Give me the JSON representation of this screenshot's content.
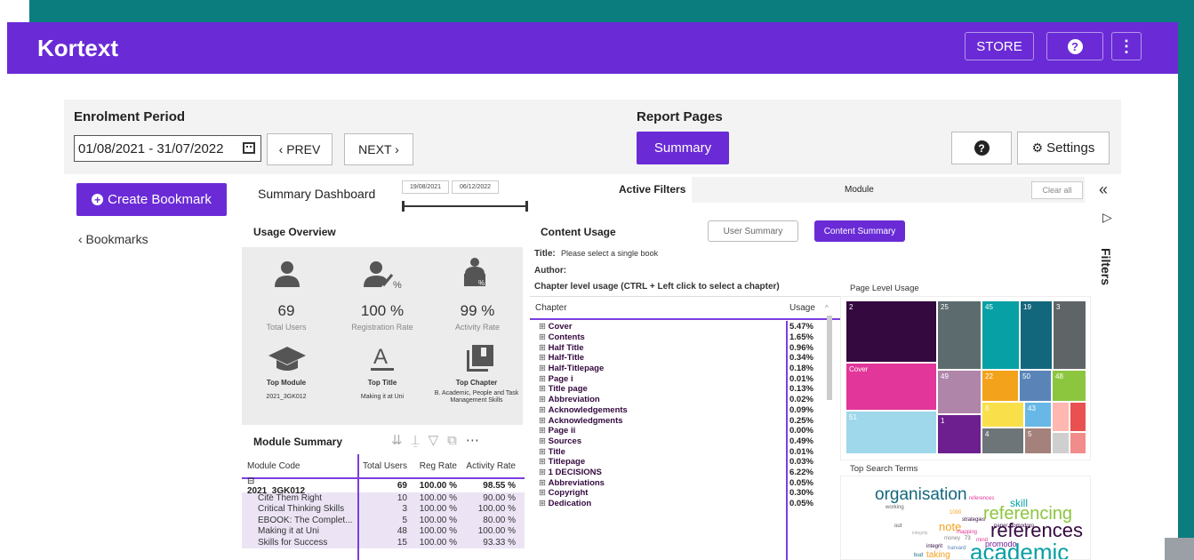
{
  "header": {
    "logo": "Kortext",
    "store_label": "STORE"
  },
  "filters": {
    "enrolment_label": "Enrolment Period",
    "date_range": "01/08/2021 - 31/07/2022",
    "prev_label": "‹ PREV",
    "next_label": "NEXT ›",
    "report_pages_label": "Report Pages",
    "summary_label": "Summary",
    "settings_label": "Settings"
  },
  "sidebar": {
    "create_bookmark": "Create Bookmark",
    "bookmarks": "‹ Bookmarks"
  },
  "dashboard": {
    "title": "Summary Dashboard",
    "slider_start": "19/08/2021",
    "slider_end": "06/12/2022",
    "active_filters_label": "Active Filters",
    "module_filter": "Module",
    "clear_all": "Clear all"
  },
  "usage_overview": {
    "title": "Usage Overview",
    "total_users_value": "69",
    "total_users_label": "Total Users",
    "reg_rate_value": "100 %",
    "reg_rate_label": "Registration Rate",
    "activity_rate_value": "99 %",
    "activity_rate_label": "Activity Rate",
    "top_module_label": "Top Module",
    "top_module_value": "2021_3GK012",
    "top_title_label": "Top Title",
    "top_title_value": "Making it at Uni",
    "top_chapter_label": "Top Chapter",
    "top_chapter_value": "B. Academic, People and Task Management Skills"
  },
  "module_summary": {
    "title": "Module Summary",
    "headers": [
      "Module Code",
      "Total Users",
      "Reg Rate",
      "Activity Rate"
    ],
    "group": {
      "code": "2021_3GK012",
      "users": "69",
      "reg": "100.00 %",
      "activity": "98.55 %"
    },
    "rows": [
      {
        "code": "Cite Them Right",
        "users": "10",
        "reg": "100.00 %",
        "activity": "90.00 %"
      },
      {
        "code": "Critical Thinking Skills",
        "users": "3",
        "reg": "100.00 %",
        "activity": "100.00 %"
      },
      {
        "code": "EBOOK: The Complet...",
        "users": "5",
        "reg": "100.00 %",
        "activity": "80.00 %"
      },
      {
        "code": "Making it at Uni",
        "users": "48",
        "reg": "100.00 %",
        "activity": "100.00 %"
      },
      {
        "code": "Skills for Success",
        "users": "15",
        "reg": "100.00 %",
        "activity": "93.33 %"
      }
    ]
  },
  "content_usage": {
    "title": "Content Usage",
    "user_summary": "User Summary",
    "content_summary": "Content Summary",
    "title_label": "Title:",
    "title_value": "Please select a single book",
    "author_label": "Author:",
    "chapter_hint": "Chapter level usage (CTRL + Left click to select a chapter)",
    "headers": [
      "Chapter",
      "Usage"
    ],
    "rows": [
      {
        "chapter": "Cover",
        "usage": "5.47%"
      },
      {
        "chapter": "Contents",
        "usage": "1.65%"
      },
      {
        "chapter": "Half Title",
        "usage": "0.96%"
      },
      {
        "chapter": "Half-Title",
        "usage": "0.34%"
      },
      {
        "chapter": "Half-Titlepage",
        "usage": "0.18%"
      },
      {
        "chapter": "Page i",
        "usage": "0.01%"
      },
      {
        "chapter": "Title page",
        "usage": "0.13%"
      },
      {
        "chapter": "Abbreviation",
        "usage": "0.02%"
      },
      {
        "chapter": "Acknowledgements",
        "usage": "0.09%"
      },
      {
        "chapter": "Acknowledgments",
        "usage": "0.25%"
      },
      {
        "chapter": "Page ii",
        "usage": "0.00%"
      },
      {
        "chapter": "Sources",
        "usage": "0.49%"
      },
      {
        "chapter": "Title",
        "usage": "0.01%"
      },
      {
        "chapter": "Titlepage",
        "usage": "0.03%"
      },
      {
        "chapter": "1 DECISIONS",
        "usage": "6.22%"
      },
      {
        "chapter": "Abbreviations",
        "usage": "0.05%"
      },
      {
        "chapter": "Copyright",
        "usage": "0.30%"
      },
      {
        "chapter": "Dedication",
        "usage": "0.05%"
      }
    ]
  },
  "page_level": {
    "title": "Page Level Usage",
    "labels": [
      "2",
      "25",
      "45",
      "19",
      "3",
      "Cover",
      "49",
      "22",
      "50",
      "48",
      "8",
      "43",
      "51",
      "1",
      "4",
      "5"
    ]
  },
  "search_terms": {
    "title": "Top Search Terms",
    "words": [
      "organisation",
      "references",
      "skill",
      "working",
      "1000",
      "referencing",
      "strategies",
      "paper",
      "pomodoro",
      "out",
      "note",
      "mapping",
      "integrity",
      "money",
      "73",
      "mind",
      "references",
      "promodo",
      "integrit",
      "harvard",
      "bud",
      "taking",
      "academic"
    ]
  },
  "filters_panel": {
    "label": "Filters"
  },
  "colors": {
    "brand": "#6a2bd6",
    "teal": "#0b7d7f"
  }
}
